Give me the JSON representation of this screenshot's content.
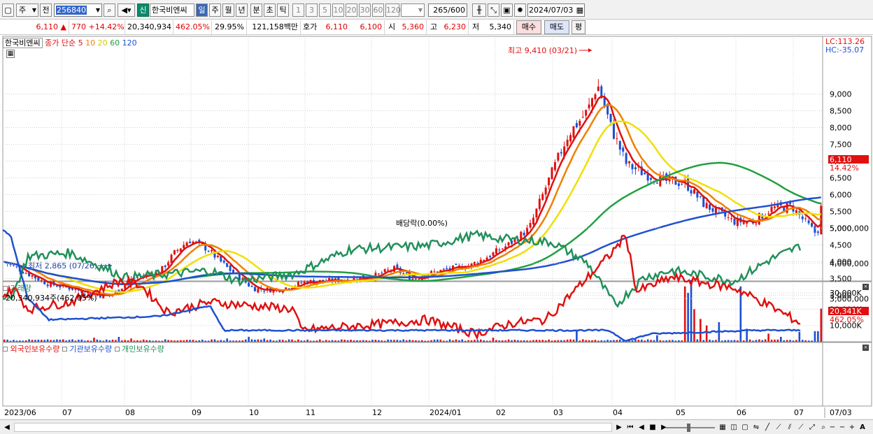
{
  "toolbar": {
    "market_type": "주",
    "prev_btn": "전",
    "stock_code": "256840",
    "new_tag": "신",
    "stock_name": "한국비엔씨",
    "periods": [
      "일",
      "주",
      "월",
      "년",
      "분",
      "초",
      "틱"
    ],
    "minutes": [
      "1",
      "3",
      "5",
      "10",
      "20",
      "30",
      "60",
      "120"
    ],
    "count": "265",
    "count_max": "/600",
    "date": "2024/07/03"
  },
  "quote": {
    "price": "6,110",
    "arrow": "▲",
    "change": "770",
    "change_pct": "+14.42%",
    "volume": "20,340,934",
    "volume_ratio": "462.05%",
    "turnover": "29.95%",
    "amount": "121,158백만",
    "ask_label": "호가",
    "ask1": "6,110",
    "ask2": "6,100",
    "open_label": "시",
    "open": "5,360",
    "high_label": "고",
    "high": "6,230",
    "low_label": "저",
    "low": "5,340",
    "buy_btn": "매수",
    "sell_btn": "매도",
    "eval_btn": "평"
  },
  "legend": {
    "name": "한국비엔씨",
    "ma_label": "종가 단순",
    "ma": [
      {
        "period": "5",
        "color": "#e01010"
      },
      {
        "period": "10",
        "color": "#f08000"
      },
      {
        "period": "20",
        "color": "#f0e000"
      },
      {
        "period": "60",
        "color": "#20a040"
      },
      {
        "period": "120",
        "color": "#2050d0"
      }
    ]
  },
  "price_panel": {
    "lc": "LC:113.26",
    "hc": "HC:-35.07",
    "ticks": [
      "9,000",
      "8,500",
      "8,000",
      "7,500",
      "7,000",
      "6,500",
      "6,000",
      "5,500",
      "5,000",
      "4,500",
      "4,000",
      "3,500",
      "3,000"
    ],
    "current_price": "6,110",
    "current_pct": "14.42%",
    "high_annot": "최고 9,410 (03/21)",
    "low_annot": "최저 2,865 (07/26)",
    "dividend_annot": "배당락(0.00%)"
  },
  "volume_panel": {
    "title": "거래량",
    "value": "20,340,934주(462.05%)",
    "ticks": [
      "30,000K",
      "20,000K",
      "10,000K"
    ],
    "current": "20,341K",
    "current_pct": "462.05%"
  },
  "holding_panel": {
    "series": [
      {
        "name": "외국인보유수량",
        "color": "#e01010"
      },
      {
        "name": "기관보유수량",
        "color": "#2050d0"
      },
      {
        "name": "개인보유수량",
        "color": "#20905a"
      }
    ],
    "ticks": [
      "5,000,000",
      "4,000,000",
      "3,000,000"
    ]
  },
  "x_axis": [
    "2023/06",
    "07",
    "08",
    "09",
    "10",
    "11",
    "12",
    "2024/01",
    "02",
    "03",
    "04",
    "05",
    "06",
    "07"
  ],
  "x_axis_right": "07/03",
  "colors": {
    "up": "#e01010",
    "down": "#1a4fd0",
    "grid": "#d0d0d0"
  }
}
